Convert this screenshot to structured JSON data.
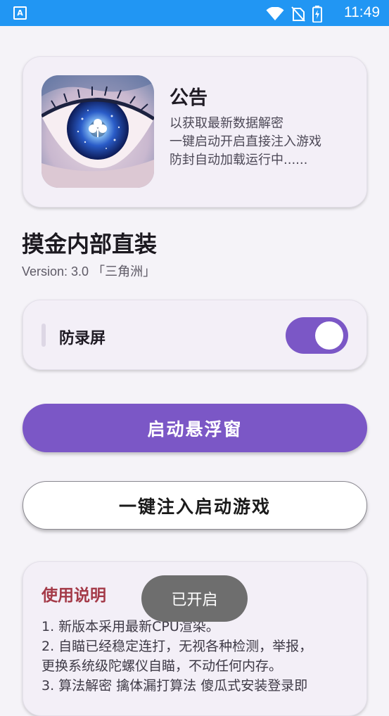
{
  "status_bar": {
    "app_icon_letter": "A",
    "time": "11:49",
    "icons": [
      "wifi-icon",
      "no-sim-icon",
      "battery-charging-icon"
    ]
  },
  "notice": {
    "title": "公告",
    "lines": [
      "以获取最新数据解密",
      "一键启动开启直接注入游戏",
      "防封自动加载运行中......"
    ],
    "image": "eye-artwork"
  },
  "app": {
    "title": "摸金内部直装",
    "version": "Version: 3.0 「三角洲」"
  },
  "anti_record": {
    "label": "防录屏",
    "enabled": true
  },
  "buttons": {
    "launch_float": "启动悬浮窗",
    "inject_launch": "一键注入启动游戏"
  },
  "usage": {
    "title": "使用说明",
    "lines": [
      "1. 新版本采用最新CPU渲染。",
      "2. 自瞄已经稳定连打，无视各种检测，举报，",
      "更换系统级陀螺仪自瞄，不动任何内存。",
      "3. 算法解密 擒体漏打算法 傻瓜式安装登录即"
    ]
  },
  "toast": {
    "text": "已开启"
  },
  "colors": {
    "status_bar": "#2196f3",
    "accent": "#7b57c6",
    "usage_title": "#a43a48",
    "background": "#f5f3f8"
  }
}
